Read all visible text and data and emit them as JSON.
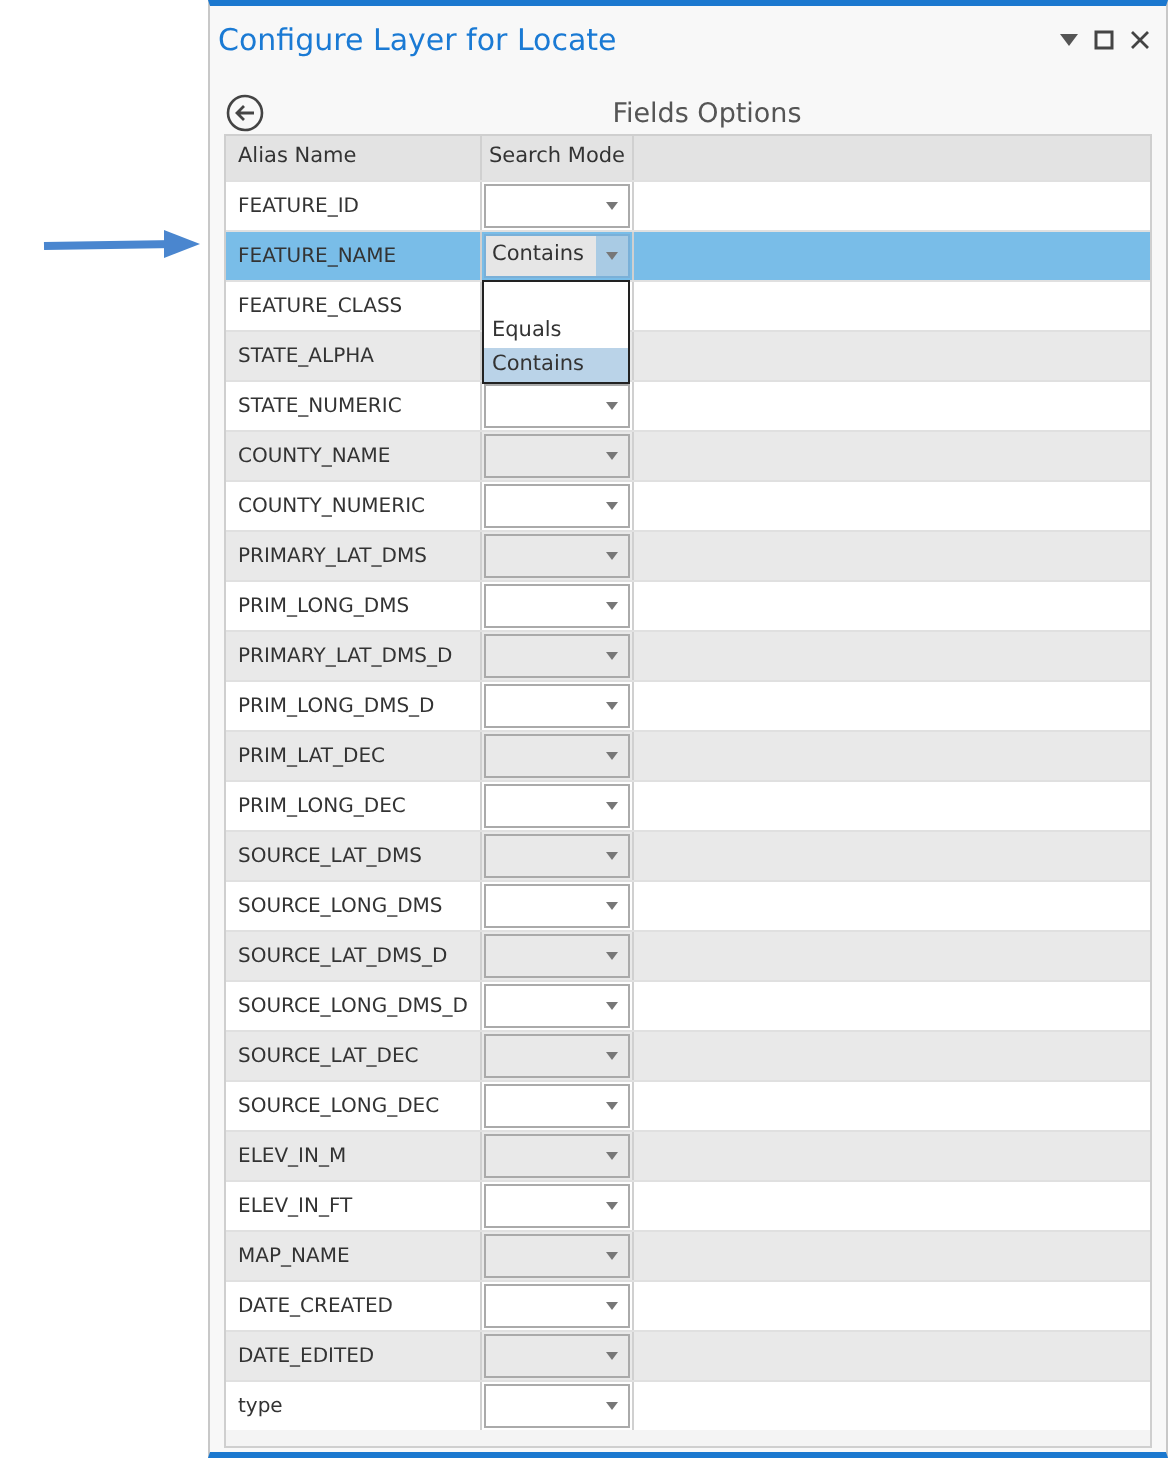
{
  "window": {
    "title": "Configure Layer for Locate"
  },
  "page_title": "Fields Options",
  "table": {
    "columns": [
      "Alias Name",
      "Search Mode"
    ],
    "rows": [
      {
        "alias": "FEATURE_ID",
        "selected": false,
        "kind": "combo",
        "value": ""
      },
      {
        "alias": "FEATURE_NAME",
        "selected": true,
        "kind": "combo",
        "value": "Contains",
        "open_list": [
          {
            "label": "Equals",
            "selected": false
          },
          {
            "label": "Contains",
            "selected": true
          }
        ]
      },
      {
        "alias": "FEATURE_CLASS",
        "selected": false,
        "kind": "covered"
      },
      {
        "alias": "STATE_ALPHA",
        "selected": false,
        "kind": "covered"
      },
      {
        "alias": "STATE_NUMERIC",
        "selected": false,
        "kind": "combo",
        "value": ""
      },
      {
        "alias": "COUNTY_NAME",
        "selected": false,
        "kind": "combo",
        "value": ""
      },
      {
        "alias": "COUNTY_NUMERIC",
        "selected": false,
        "kind": "combo",
        "value": ""
      },
      {
        "alias": "PRIMARY_LAT_DMS",
        "selected": false,
        "kind": "combo",
        "value": ""
      },
      {
        "alias": "PRIM_LONG_DMS",
        "selected": false,
        "kind": "combo",
        "value": ""
      },
      {
        "alias": "PRIMARY_LAT_DMS_D",
        "selected": false,
        "kind": "combo",
        "value": ""
      },
      {
        "alias": "PRIM_LONG_DMS_D",
        "selected": false,
        "kind": "combo",
        "value": ""
      },
      {
        "alias": "PRIM_LAT_DEC",
        "selected": false,
        "kind": "combo",
        "value": ""
      },
      {
        "alias": "PRIM_LONG_DEC",
        "selected": false,
        "kind": "combo",
        "value": ""
      },
      {
        "alias": "SOURCE_LAT_DMS",
        "selected": false,
        "kind": "combo",
        "value": ""
      },
      {
        "alias": "SOURCE_LONG_DMS",
        "selected": false,
        "kind": "combo",
        "value": ""
      },
      {
        "alias": "SOURCE_LAT_DMS_D",
        "selected": false,
        "kind": "combo",
        "value": ""
      },
      {
        "alias": "SOURCE_LONG_DMS_D",
        "selected": false,
        "kind": "combo",
        "value": ""
      },
      {
        "alias": "SOURCE_LAT_DEC",
        "selected": false,
        "kind": "combo",
        "value": ""
      },
      {
        "alias": "SOURCE_LONG_DEC",
        "selected": false,
        "kind": "combo",
        "value": ""
      },
      {
        "alias": "ELEV_IN_M",
        "selected": false,
        "kind": "combo",
        "value": ""
      },
      {
        "alias": "ELEV_IN_FT",
        "selected": false,
        "kind": "combo",
        "value": ""
      },
      {
        "alias": "MAP_NAME",
        "selected": false,
        "kind": "combo",
        "value": ""
      },
      {
        "alias": "DATE_CREATED",
        "selected": false,
        "kind": "combo",
        "value": ""
      },
      {
        "alias": "DATE_EDITED",
        "selected": false,
        "kind": "combo",
        "value": ""
      },
      {
        "alias": "type",
        "selected": false,
        "kind": "combo",
        "value": ""
      }
    ]
  }
}
